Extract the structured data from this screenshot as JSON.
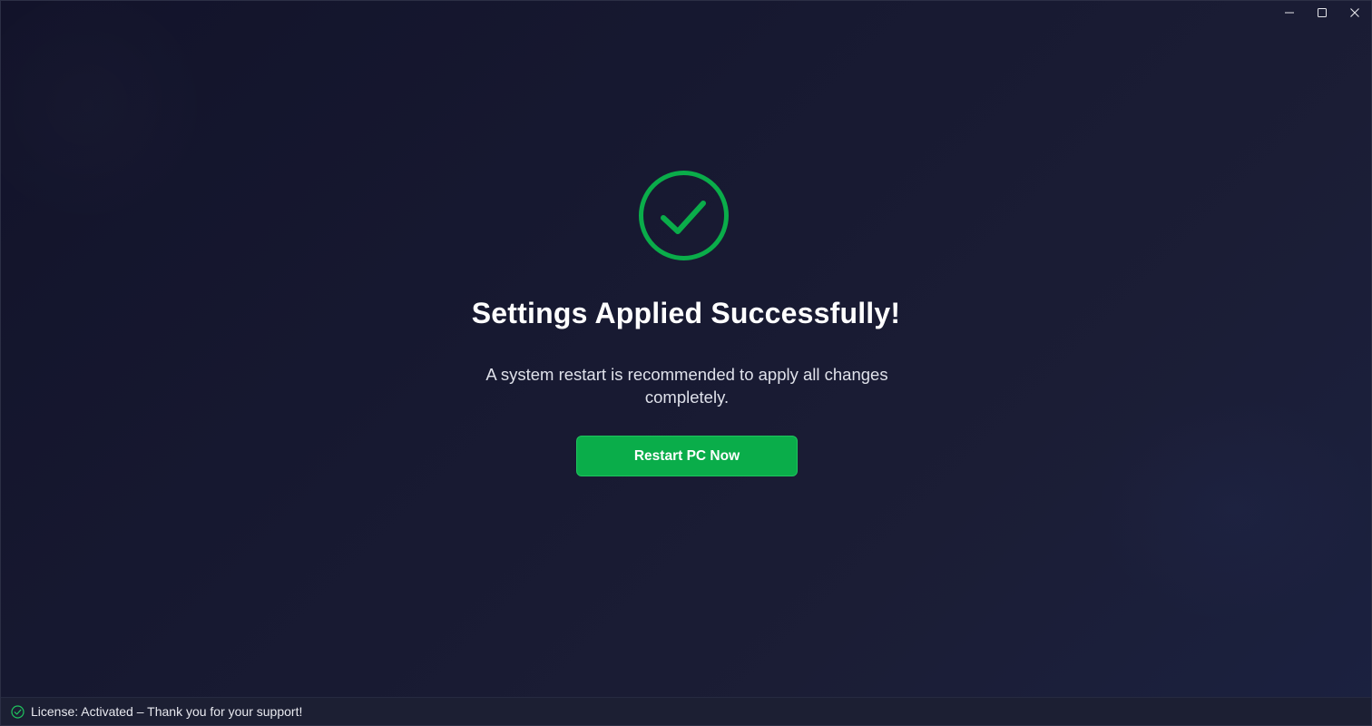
{
  "window": {
    "controls": {
      "minimize_icon": "minimize-icon",
      "maximize_icon": "maximize-icon",
      "close_icon": "close-icon"
    }
  },
  "main": {
    "icon": "check-circle-icon",
    "title": "Settings Applied Successfully!",
    "message": "A system restart is recommended to apply all changes completely.",
    "restart_button_label": "Restart PC Now"
  },
  "status": {
    "icon": "check-circle-small-icon",
    "text": "License: Activated – Thank you for your support!"
  },
  "colors": {
    "accent_green": "#0aad4a",
    "background": "#171931",
    "text_primary": "#ffffff"
  }
}
